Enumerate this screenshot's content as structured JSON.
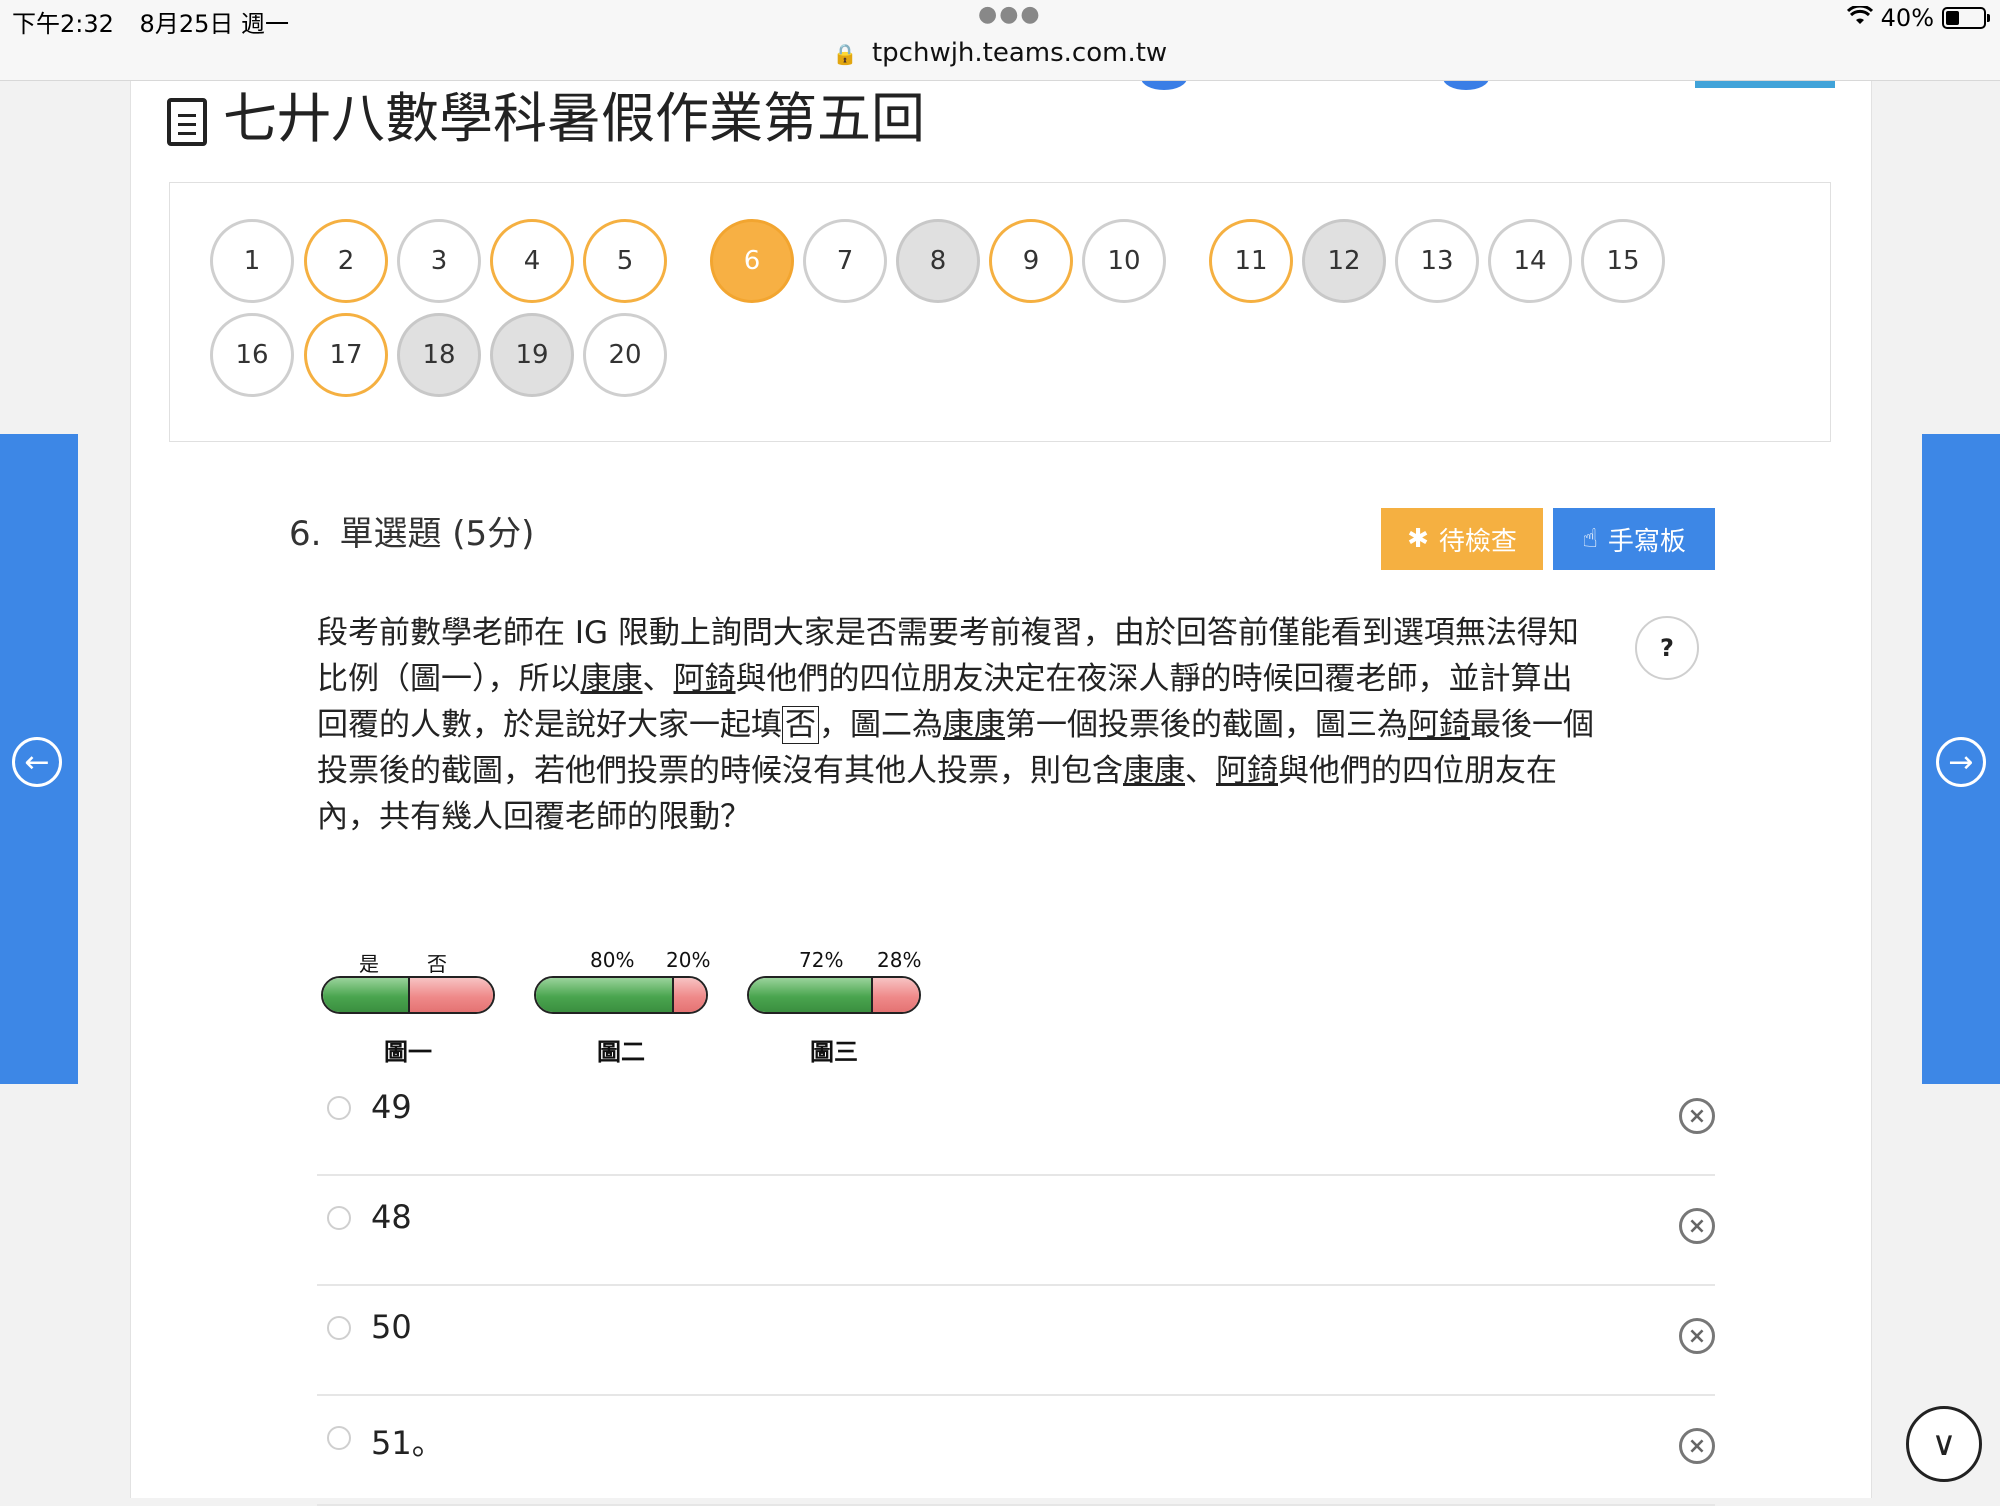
{
  "status_bar": {
    "time": "下午2:32",
    "date": "8月25日 週一",
    "url": "tpchwjh.teams.com.tw",
    "battery": "40%",
    "battery_level": 0.4
  },
  "page": {
    "title": "七廾八數學科暑假作業第五回"
  },
  "question_nav": [
    {
      "n": "1",
      "state": "unanswered"
    },
    {
      "n": "2",
      "state": "answered"
    },
    {
      "n": "3",
      "state": "unanswered"
    },
    {
      "n": "4",
      "state": "answered"
    },
    {
      "n": "5",
      "state": "answered"
    },
    {
      "n": "6",
      "state": "current"
    },
    {
      "n": "7",
      "state": "unanswered"
    },
    {
      "n": "8",
      "state": "marked"
    },
    {
      "n": "9",
      "state": "answered"
    },
    {
      "n": "10",
      "state": "unanswered"
    },
    {
      "n": "11",
      "state": "answered"
    },
    {
      "n": "12",
      "state": "marked"
    },
    {
      "n": "13",
      "state": "unanswered"
    },
    {
      "n": "14",
      "state": "unanswered"
    },
    {
      "n": "15",
      "state": "unanswered"
    },
    {
      "n": "16",
      "state": "unanswered"
    },
    {
      "n": "17",
      "state": "answered"
    },
    {
      "n": "18",
      "state": "marked"
    },
    {
      "n": "19",
      "state": "marked"
    },
    {
      "n": "20",
      "state": "unanswered"
    }
  ],
  "question": {
    "number": "6.",
    "type": "單選題 (5分)",
    "review_label": "待檢查",
    "handwrite_label": "手寫板",
    "help_label": "?",
    "text": {
      "p1": "段考前數學老師在 IG 限動上詢問大家是否需要考前複習，由於回答前僅能看到選項無法得知比例（圖一），所以",
      "name_kang": "康康",
      "sep1": "、",
      "name_qi": "阿錡",
      "p2": "與他們的四位朋友決定在夜深人靜的時候回覆老師，並計算出回覆的人數，於是說好大家一起填",
      "boxed": "否",
      "p3": "，圖二為",
      "p4": "第一個投票後的截圖，圖三為",
      "p5": "最後一個投票後的截圖，若他們投票的時候沒有其他人投票，則包含",
      "p6": "與他們的四位朋友在內，共有幾人回覆老師的限動？"
    },
    "figures": [
      {
        "left_label": "是",
        "right_label": "否",
        "green_fraction": 0.5,
        "caption": "圖一"
      },
      {
        "left_label": "80%",
        "right_label": "20%",
        "green_fraction": 0.8,
        "caption": "圖二"
      },
      {
        "left_label": "72%",
        "right_label": "28%",
        "green_fraction": 0.72,
        "caption": "圖三"
      }
    ],
    "options": [
      "49",
      "48",
      "50",
      "51。"
    ]
  },
  "icons": {
    "left_arrow": "←",
    "right_arrow": "→",
    "scroll_down": "∨",
    "eliminate": "×",
    "review": "✱",
    "hand": "☝",
    "lock": "🔒"
  },
  "colors": {
    "accent_blue": "#3d87e6",
    "accent_orange": "#f5b041"
  }
}
